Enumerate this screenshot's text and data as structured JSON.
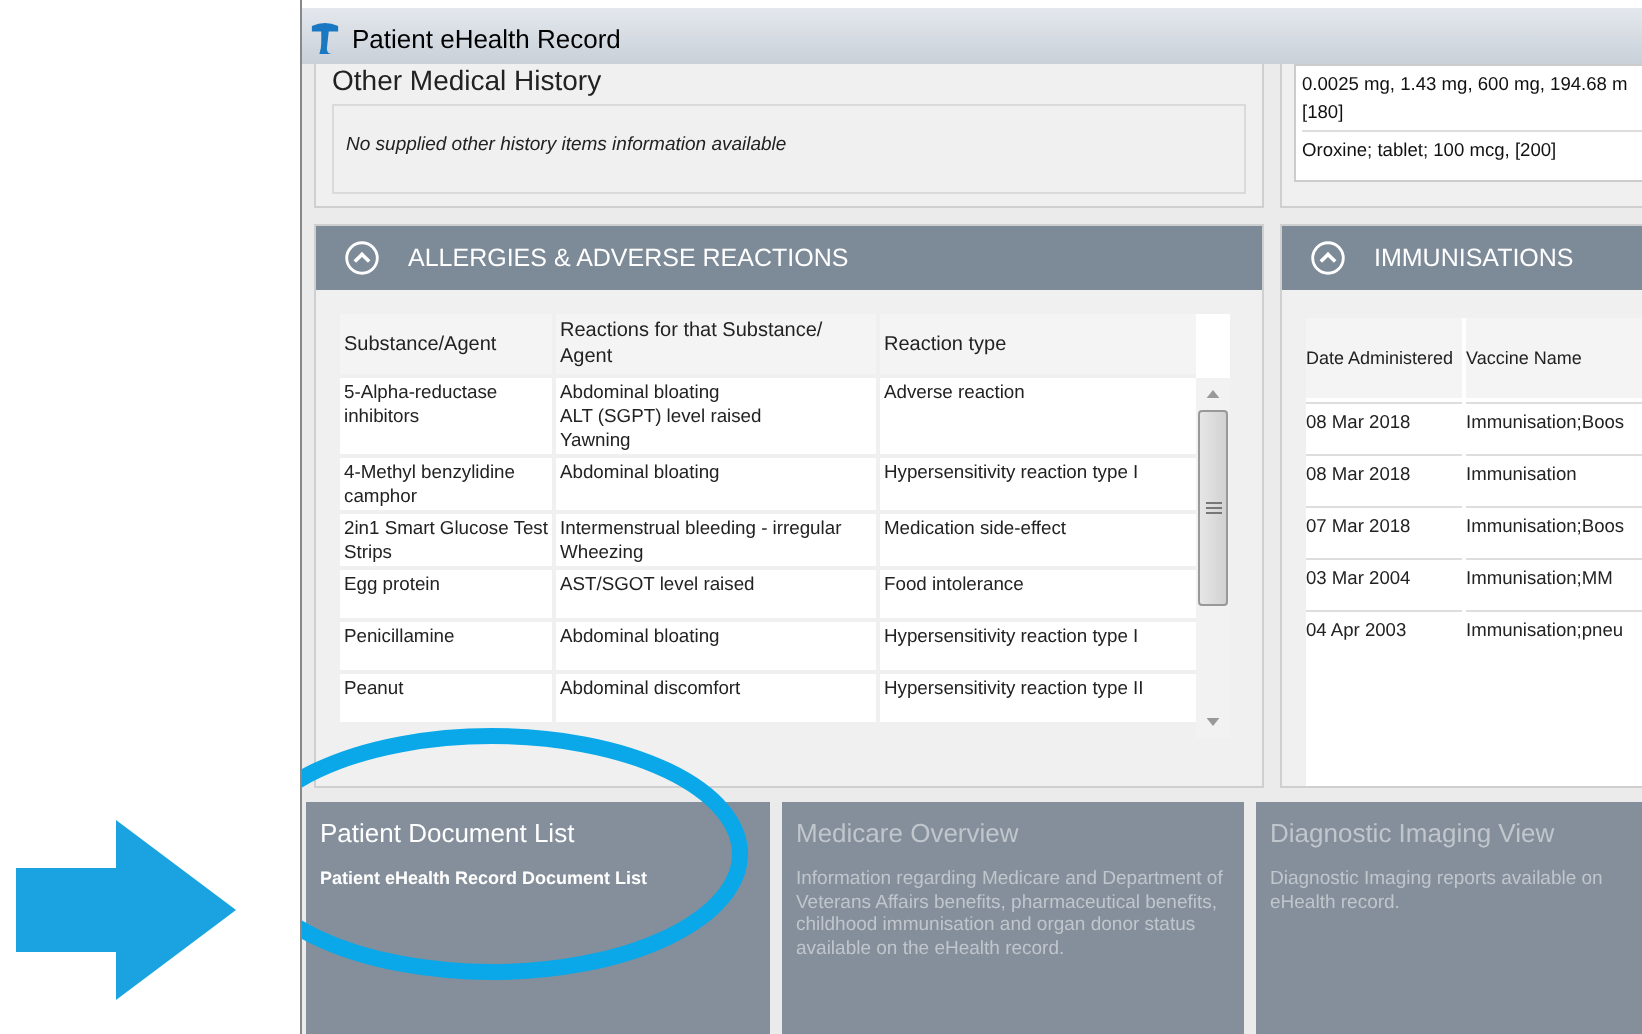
{
  "window": {
    "title": "Patient eHealth Record"
  },
  "other_history": {
    "title": "Other Medical History",
    "message": "No supplied other history items information available"
  },
  "medications": {
    "lines": [
      "0.0025 mg, 1.43 mg, 600 mg, 194.68 m",
      "[180]",
      "Oroxine; tablet; 100 mcg, [200]"
    ]
  },
  "allergies": {
    "title": "ALLERGIES & ADVERSE REACTIONS",
    "expanded": true,
    "columns": [
      "Substance/Agent",
      "Reactions for that Substance/ Agent",
      "Reaction type"
    ],
    "rows": [
      {
        "substance": "5-Alpha-reductase inhibitors",
        "reactions": [
          "Abdominal bloating",
          "ALT (SGPT) level raised",
          "Yawning"
        ],
        "type": "Adverse reaction"
      },
      {
        "substance": "4-Methyl benzylidine camphor",
        "reactions": [
          "Abdominal bloating"
        ],
        "type": "Hypersensitivity reaction type I"
      },
      {
        "substance": "2in1 Smart Glucose Test Strips",
        "reactions": [
          "Intermenstrual bleeding - irregular",
          "Wheezing"
        ],
        "type": "Medication side-effect"
      },
      {
        "substance": "Egg protein",
        "reactions": [
          "AST/SGOT level raised"
        ],
        "type": "Food intolerance"
      },
      {
        "substance": "Penicillamine",
        "reactions": [
          "Abdominal bloating"
        ],
        "type": "Hypersensitivity reaction type I"
      },
      {
        "substance": "Peanut",
        "reactions": [
          "Abdominal discomfort"
        ],
        "type": "Hypersensitivity reaction type II"
      }
    ]
  },
  "immunisations": {
    "title": "IMMUNISATIONS",
    "expanded": true,
    "columns": [
      "Date Administered",
      "Vaccine Name"
    ],
    "rows": [
      {
        "date": "08 Mar 2018",
        "vaccine": "Immunisation;Boos"
      },
      {
        "date": "08 Mar 2018",
        "vaccine": "Immunisation"
      },
      {
        "date": "07 Mar 2018",
        "vaccine": "Immunisation;Boos"
      },
      {
        "date": "03 Mar 2004",
        "vaccine": "Immunisation;MM"
      },
      {
        "date": "04 Apr 2003",
        "vaccine": "Immunisation;pneu"
      }
    ]
  },
  "tiles": [
    {
      "title": "Patient Document List",
      "description": "Patient eHealth Record Document List",
      "disabled": false
    },
    {
      "title": "Medicare Overview",
      "description": "Information regarding Medicare and Department of Veterans Affairs benefits, pharmaceutical benefits, childhood immunisation and organ donor status available on the eHealth record.",
      "disabled": true
    },
    {
      "title": "Diagnostic Imaging View",
      "description": "Diagnostic Imaging reports available on eHealth record.",
      "disabled": true
    }
  ]
}
